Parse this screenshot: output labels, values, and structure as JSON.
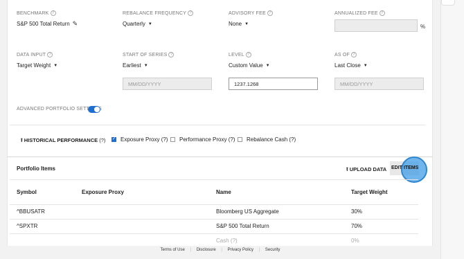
{
  "settings": {
    "benchmark": {
      "label": "BENCHMARK",
      "value": "S&P 500 Total Return"
    },
    "rebalance_frequency": {
      "label": "REBALANCE FREQUENCY",
      "value": "Quarterly"
    },
    "advisory_fee": {
      "label": "ADVISORY FEE",
      "value": "None"
    },
    "annualized_fee": {
      "label": "ANNUALIZED FEE",
      "value": "",
      "suffix": "%"
    },
    "data_input": {
      "label": "DATA INPUT",
      "value": "Target Weight"
    },
    "start_of_series": {
      "label": "START OF SERIES",
      "value": "Earliest",
      "placeholder": "MM/DD/YYYY"
    },
    "level": {
      "label": "LEVEL",
      "value": "Custom Value",
      "input_value": "1237.1268"
    },
    "as_of": {
      "label": "AS OF",
      "value": "Last Close",
      "placeholder": "MM/DD/YYYY"
    },
    "help_glyph": "?",
    "advanced": {
      "label": "ADVANCED PORTFOLIO SETTINGS",
      "enabled": true
    }
  },
  "history": {
    "label": "HISTORICAL PERFORMANCE",
    "help": "(?)",
    "options": [
      {
        "label": "Exposure Proxy (?)",
        "checked": true
      },
      {
        "label": "Performance Proxy (?)",
        "checked": false
      },
      {
        "label": "Rebalance Cash (?)",
        "checked": false
      }
    ]
  },
  "portfolio": {
    "title": "Portfolio Items",
    "upload_label": "UPLOAD DATA",
    "edit_label": "EDIT ITEMS",
    "columns": [
      "Symbol",
      "Exposure Proxy",
      "Name",
      "Target Weight"
    ],
    "rows": [
      {
        "symbol": "^BBUSATR",
        "proxy": "",
        "name": "Bloomberg US Aggregate",
        "weight": "30%"
      },
      {
        "symbol": "^SPXTR",
        "proxy": "",
        "name": "S&P 500 Total Return",
        "weight": "70%"
      },
      {
        "symbol": "",
        "proxy": "",
        "name": "Cash (?)",
        "weight": "0%"
      }
    ]
  },
  "footer": {
    "links": [
      "Terms of Use",
      "Disclosure",
      "Privacy Policy",
      "Security"
    ],
    "separator": "|"
  },
  "colors": {
    "accent": "#1f6fd1",
    "highlight": "#409ce6"
  }
}
